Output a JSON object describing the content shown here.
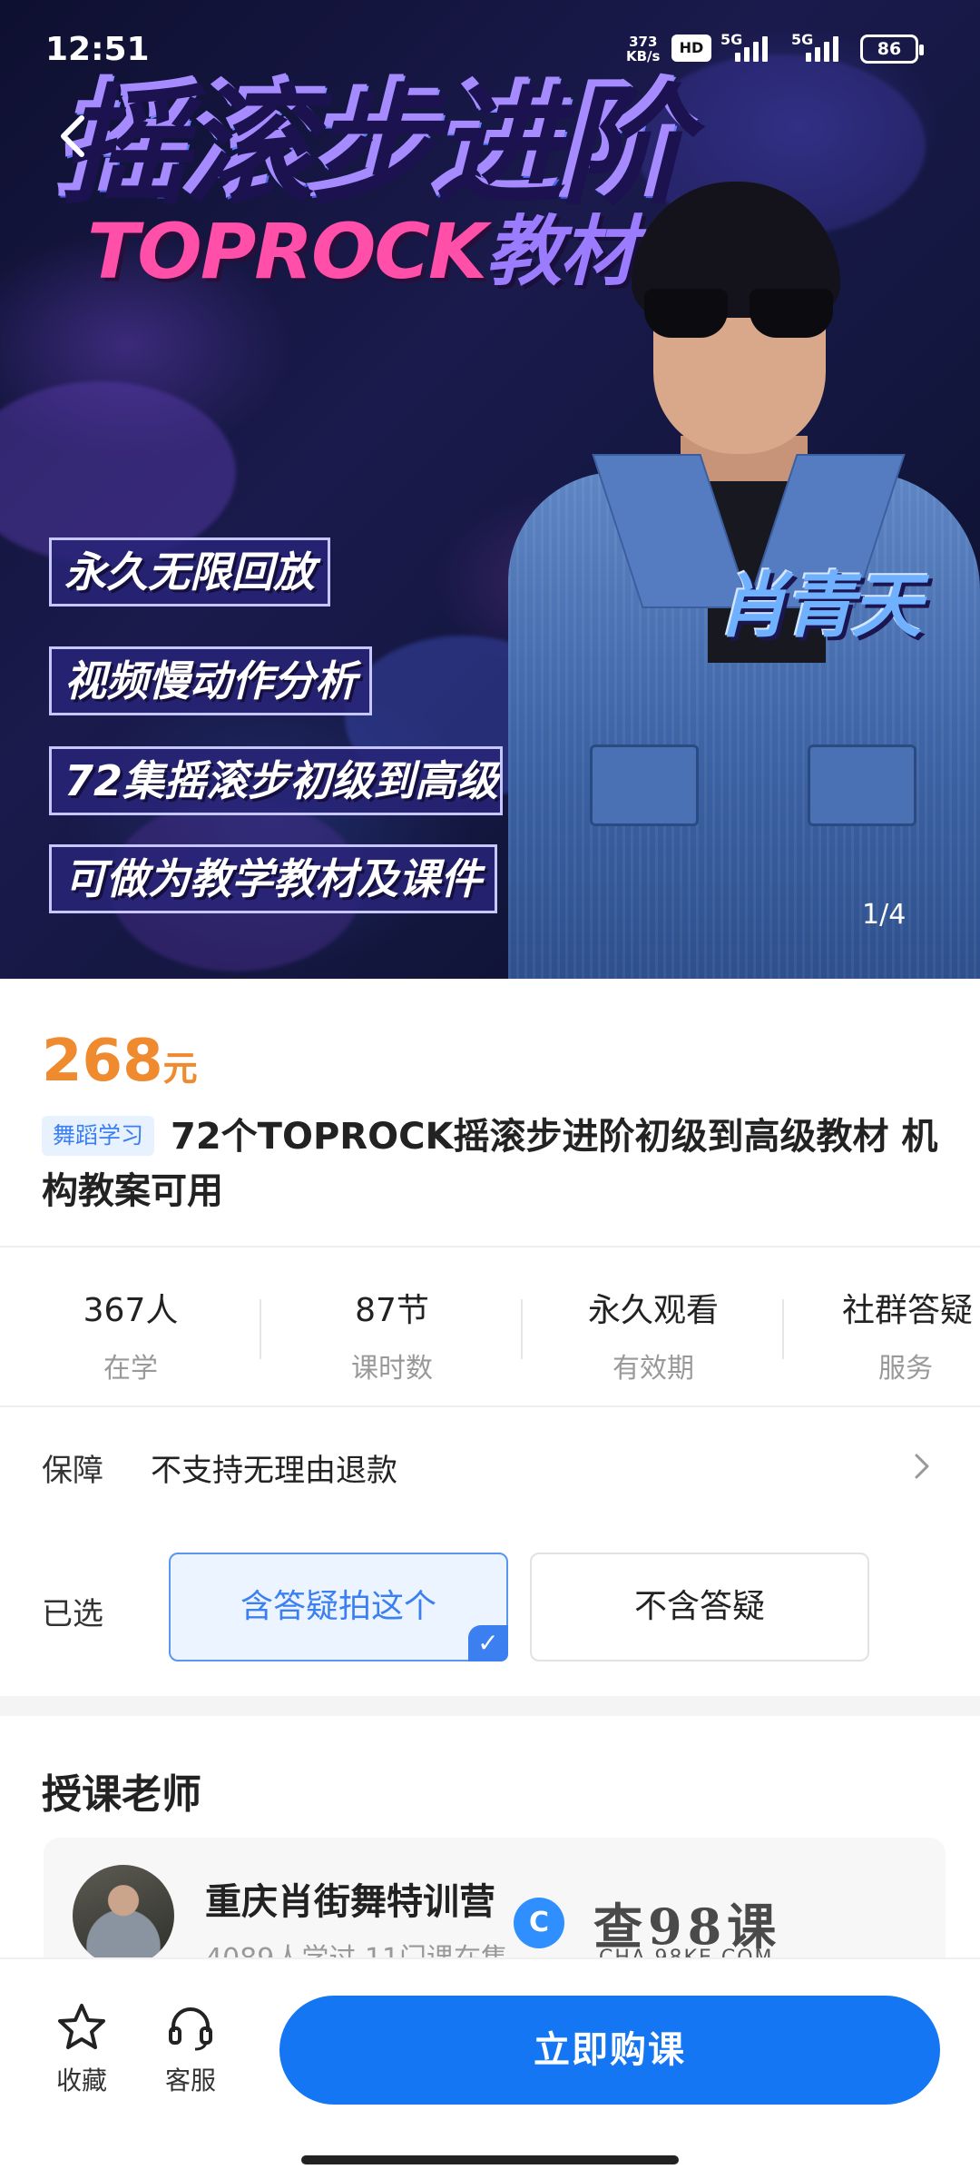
{
  "status": {
    "time": "12:51",
    "speed_value": "373",
    "speed_unit": "KB/s",
    "hd": "HD",
    "net1": "5G",
    "net2": "5G",
    "battery": "86"
  },
  "banner": {
    "title_main": "摇滚步进阶",
    "title_sub_a": "TOPROCK",
    "title_sub_b": "教材",
    "features": [
      "永久无限回放",
      "视频慢动作分析",
      "72集摇滚步初级到高级",
      "可做为教学教材及课件"
    ],
    "name": "肖青天",
    "pager": "1/4"
  },
  "product": {
    "price": "268",
    "price_unit": "元",
    "category_tag": "舞蹈学习",
    "title": "72个TOPROCK摇滚步进阶初级到高级教材 机构教案可用"
  },
  "stats": [
    {
      "value": "367人",
      "label": "在学"
    },
    {
      "value": "87节",
      "label": "课时数"
    },
    {
      "value": "永久观看",
      "label": "有效期"
    },
    {
      "value": "社群答疑",
      "label": "服务"
    }
  ],
  "guarantee": {
    "label": "保障",
    "value": "不支持无理由退款"
  },
  "options": {
    "label": "已选",
    "selected": "含答疑拍这个",
    "other": "不含答疑"
  },
  "teacher": {
    "section_title": "授课老师",
    "name": "重庆肖街舞特训营",
    "meta": "4089人学过 11门课在售"
  },
  "watermark": {
    "text": "查98课",
    "sub": "CHA.98KE.COM"
  },
  "bottom": {
    "favorite": "收藏",
    "service": "客服",
    "buy": "立即购课"
  },
  "colors": {
    "price": "#f08a2e",
    "accent": "#1476f2",
    "tag_bg": "#e8f2ff"
  }
}
